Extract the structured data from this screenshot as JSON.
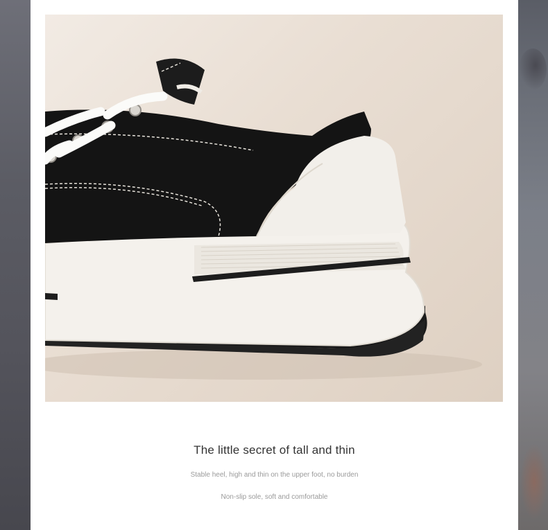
{
  "product": {
    "title": "The little secret of tall and thin",
    "features": [
      "Stable heel, high and thin on the upper foot, no burden",
      "Non-slip sole, soft and comfortable"
    ],
    "image": {
      "alt": "Close-up of black canvas sneaker with white platform sole",
      "colors": {
        "canvas": "#141414",
        "sole": "#f4f1ec",
        "outsole": "#1c1c1c",
        "background": "#e9ded3"
      }
    }
  }
}
